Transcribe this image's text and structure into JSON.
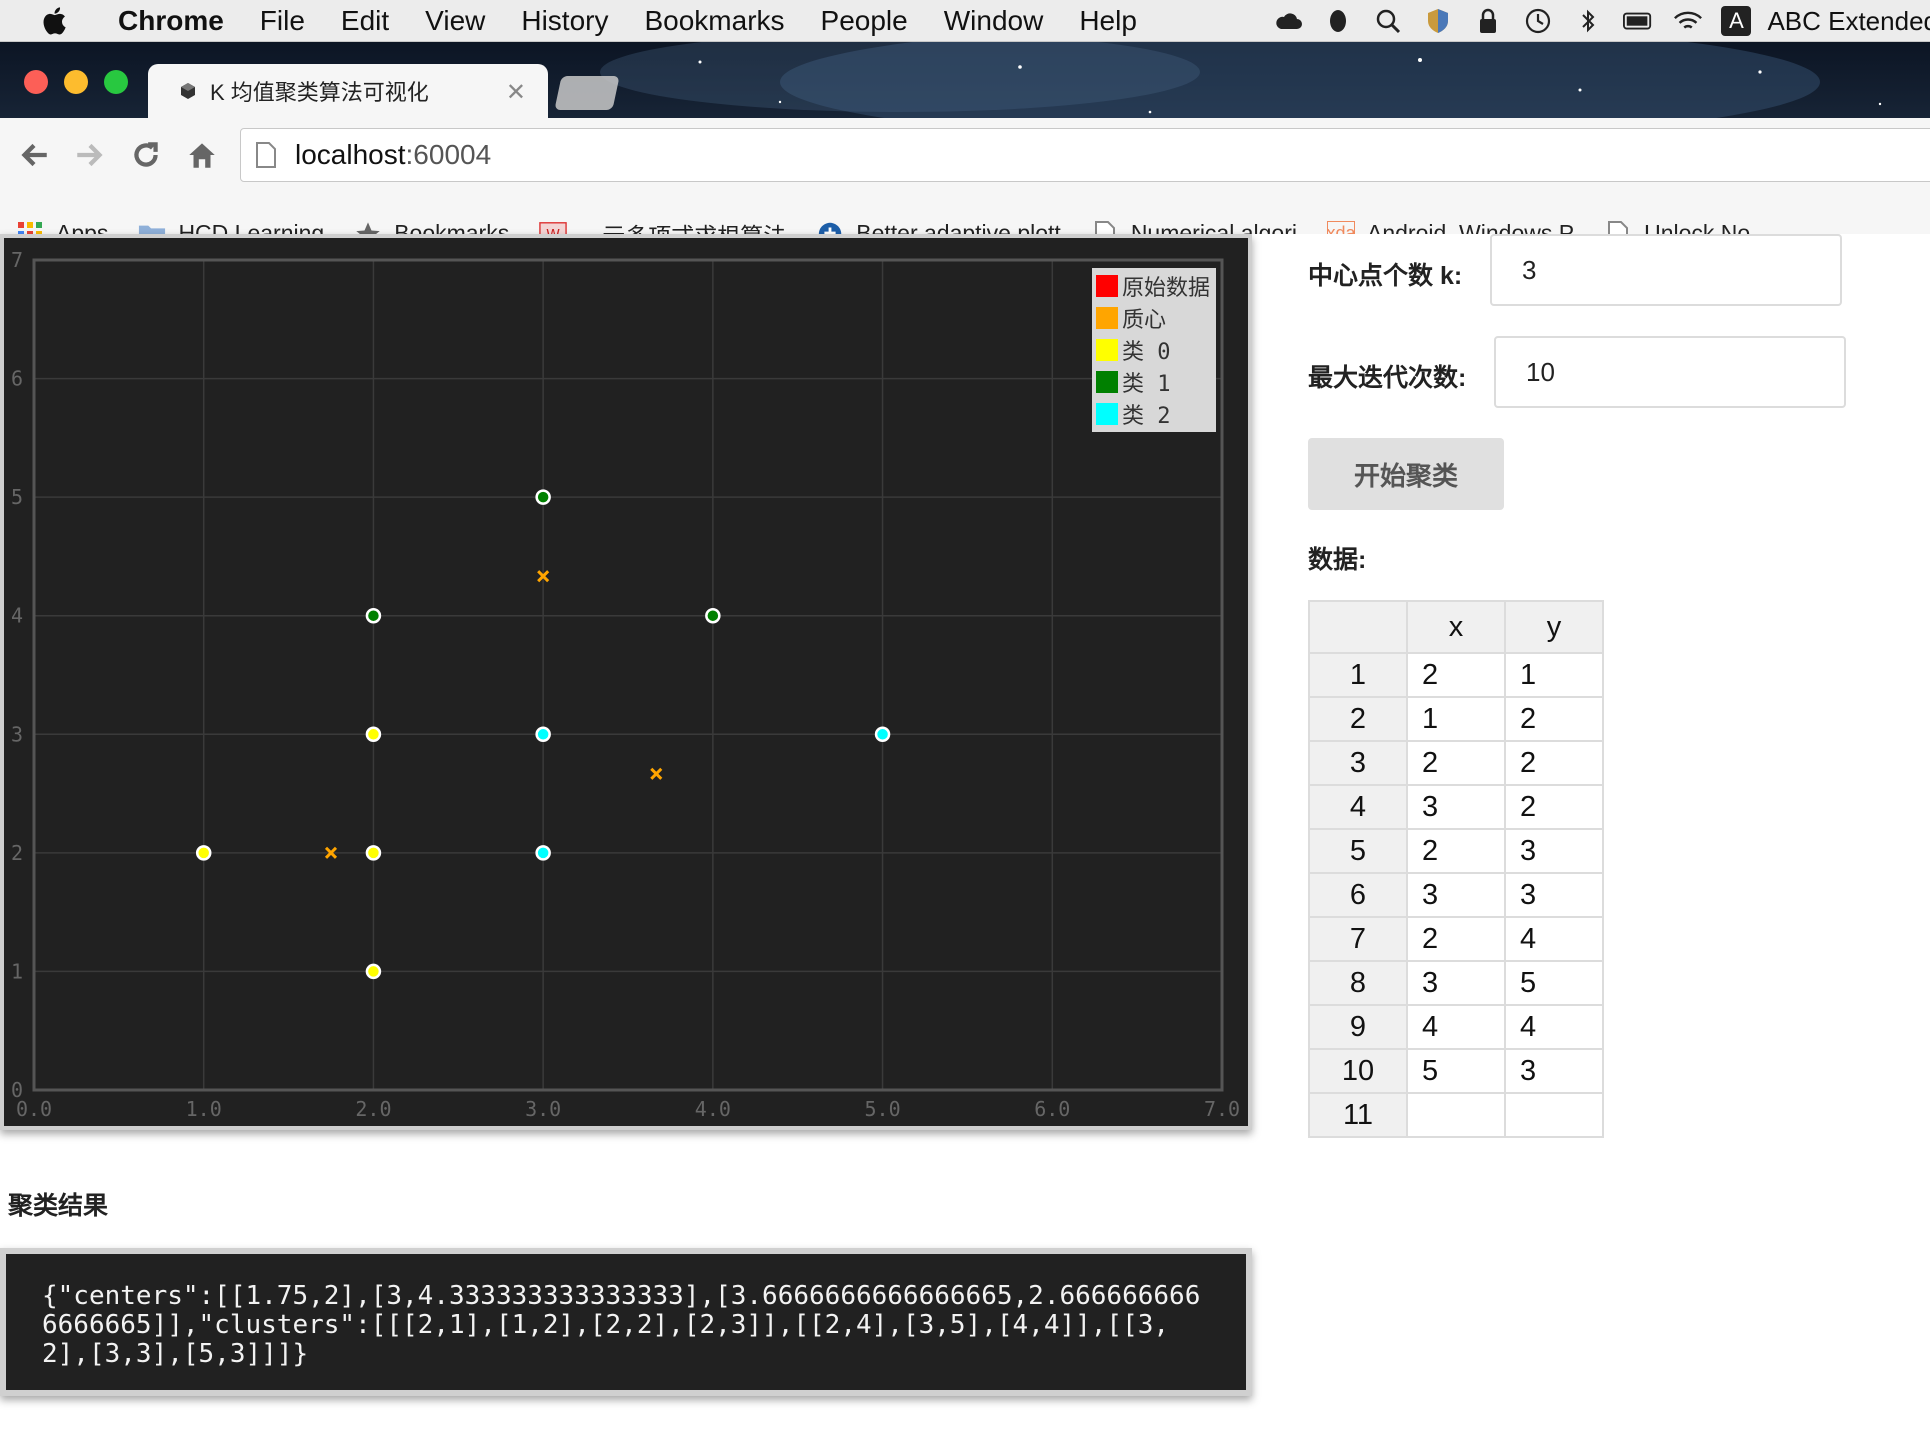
{
  "menubar": {
    "app_name": "Chrome",
    "items": [
      "File",
      "Edit",
      "View",
      "History",
      "Bookmarks",
      "People",
      "Window",
      "Help"
    ],
    "input_method": "ABC Extended",
    "input_badge": "A"
  },
  "browser": {
    "tab_title": "K 均值聚类算法可视化",
    "tab_close": "✕",
    "url_host": "localhost",
    "url_port": ":60004",
    "bookmarks": [
      {
        "label": "Apps",
        "icon": "apps-grid-icon"
      },
      {
        "label": "HCD Learning",
        "icon": "folder-icon"
      },
      {
        "label": "Bookmarks",
        "icon": "star-icon"
      },
      {
        "label": "一元多项式求根算法",
        "icon": "site-favicon"
      },
      {
        "label": "Better adaptive plott",
        "icon": "site-favicon"
      },
      {
        "label": "Numerical algori",
        "icon": "page-icon"
      },
      {
        "label": "Android, Windows P",
        "icon": "xda-favicon"
      },
      {
        "label": "Unlock No",
        "icon": "page-icon"
      }
    ]
  },
  "controls": {
    "k_label": "中心点个数 k:",
    "k_value": "3",
    "iter_label": "最大迭代次数:",
    "iter_value": "10",
    "start_button": "开始聚类",
    "data_label": "数据:"
  },
  "table": {
    "headers": [
      "x",
      "y"
    ],
    "rows": [
      {
        "index": "1",
        "x": "2",
        "y": "1"
      },
      {
        "index": "2",
        "x": "1",
        "y": "2"
      },
      {
        "index": "3",
        "x": "2",
        "y": "2"
      },
      {
        "index": "4",
        "x": "3",
        "y": "2"
      },
      {
        "index": "5",
        "x": "2",
        "y": "3"
      },
      {
        "index": "6",
        "x": "3",
        "y": "3"
      },
      {
        "index": "7",
        "x": "2",
        "y": "4"
      },
      {
        "index": "8",
        "x": "3",
        "y": "5"
      },
      {
        "index": "9",
        "x": "4",
        "y": "4"
      },
      {
        "index": "10",
        "x": "5",
        "y": "3"
      },
      {
        "index": "11",
        "x": "",
        "y": ""
      }
    ]
  },
  "result": {
    "title": "聚类结果",
    "json_text": "{\"centers\":[[1.75,2],[3,4.333333333333333],[3.6666666666666665,2.6666666666666665]],\"clusters\":[[[2,1],[1,2],[2,2],[2,3]],[[2,4],[3,5],[4,4]],[[3,2],[3,3],[5,3]]]}"
  },
  "chart_data": {
    "type": "scatter",
    "xlim": [
      0,
      7
    ],
    "ylim": [
      0,
      7
    ],
    "x_ticks": [
      "0.0",
      "1.0",
      "2.0",
      "3.0",
      "4.0",
      "5.0",
      "6.0",
      "7.0"
    ],
    "y_ticks": [
      "0",
      "1",
      "2",
      "3",
      "4",
      "5",
      "6",
      "7"
    ],
    "grid": true,
    "legend_position": "top-right",
    "legend": [
      {
        "name": "原始数据",
        "color": "#ff0000"
      },
      {
        "name": "质心",
        "color": "#ffa500"
      },
      {
        "name": "类 0",
        "color": "#ffff00"
      },
      {
        "name": "类 1",
        "color": "#008000"
      },
      {
        "name": "类 2",
        "color": "#00ffff"
      }
    ],
    "series": [
      {
        "name": "质心",
        "marker": "x",
        "color": "#ffa500",
        "points": [
          [
            1.75,
            2
          ],
          [
            3,
            4.333333333333333
          ],
          [
            3.6666666666666665,
            2.6666666666666665
          ]
        ]
      },
      {
        "name": "类 0",
        "marker": "circle",
        "color": "#ffff00",
        "points": [
          [
            2,
            1
          ],
          [
            1,
            2
          ],
          [
            2,
            2
          ],
          [
            2,
            3
          ]
        ]
      },
      {
        "name": "类 1",
        "marker": "circle",
        "color": "#008000",
        "points": [
          [
            2,
            4
          ],
          [
            3,
            5
          ],
          [
            4,
            4
          ]
        ]
      },
      {
        "name": "类 2",
        "marker": "circle",
        "color": "#00ffff",
        "points": [
          [
            3,
            2
          ],
          [
            3,
            3
          ],
          [
            5,
            3
          ]
        ]
      }
    ]
  }
}
